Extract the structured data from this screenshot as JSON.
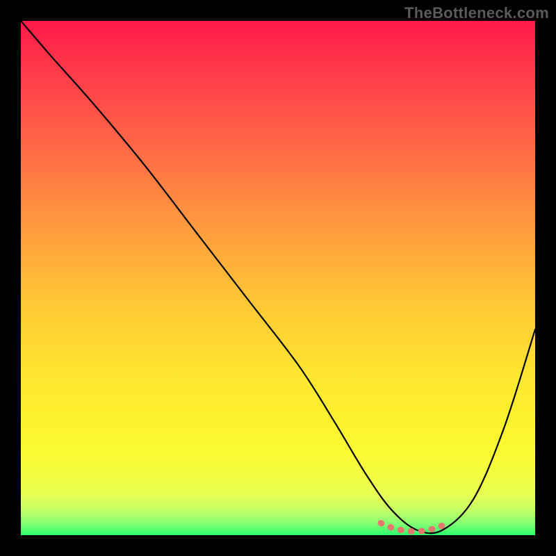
{
  "watermark": "TheBottleneck.com",
  "chart_data": {
    "type": "line",
    "title": "",
    "xlabel": "",
    "ylabel": "",
    "xlim": [
      0,
      100
    ],
    "ylim": [
      0,
      100
    ],
    "grid": false,
    "legend": false,
    "background_gradient": {
      "top": "#ff1a4a",
      "middle": "#ffe430",
      "bottom": "#2bff6e"
    },
    "series": [
      {
        "name": "bottleneck-curve",
        "color": "#000000",
        "x": [
          0,
          6,
          14,
          24,
          34,
          44,
          54,
          61,
          67,
          72,
          77,
          82,
          88,
          94,
          100
        ],
        "values": [
          100,
          93,
          84,
          72,
          59,
          46,
          33,
          22,
          12,
          5,
          1,
          1,
          7,
          21,
          40
        ]
      }
    ],
    "annotations": [
      {
        "name": "minimum-marker",
        "color": "#e4776e",
        "x_range": [
          70,
          83
        ],
        "y": 1,
        "style": "dotted"
      }
    ]
  }
}
